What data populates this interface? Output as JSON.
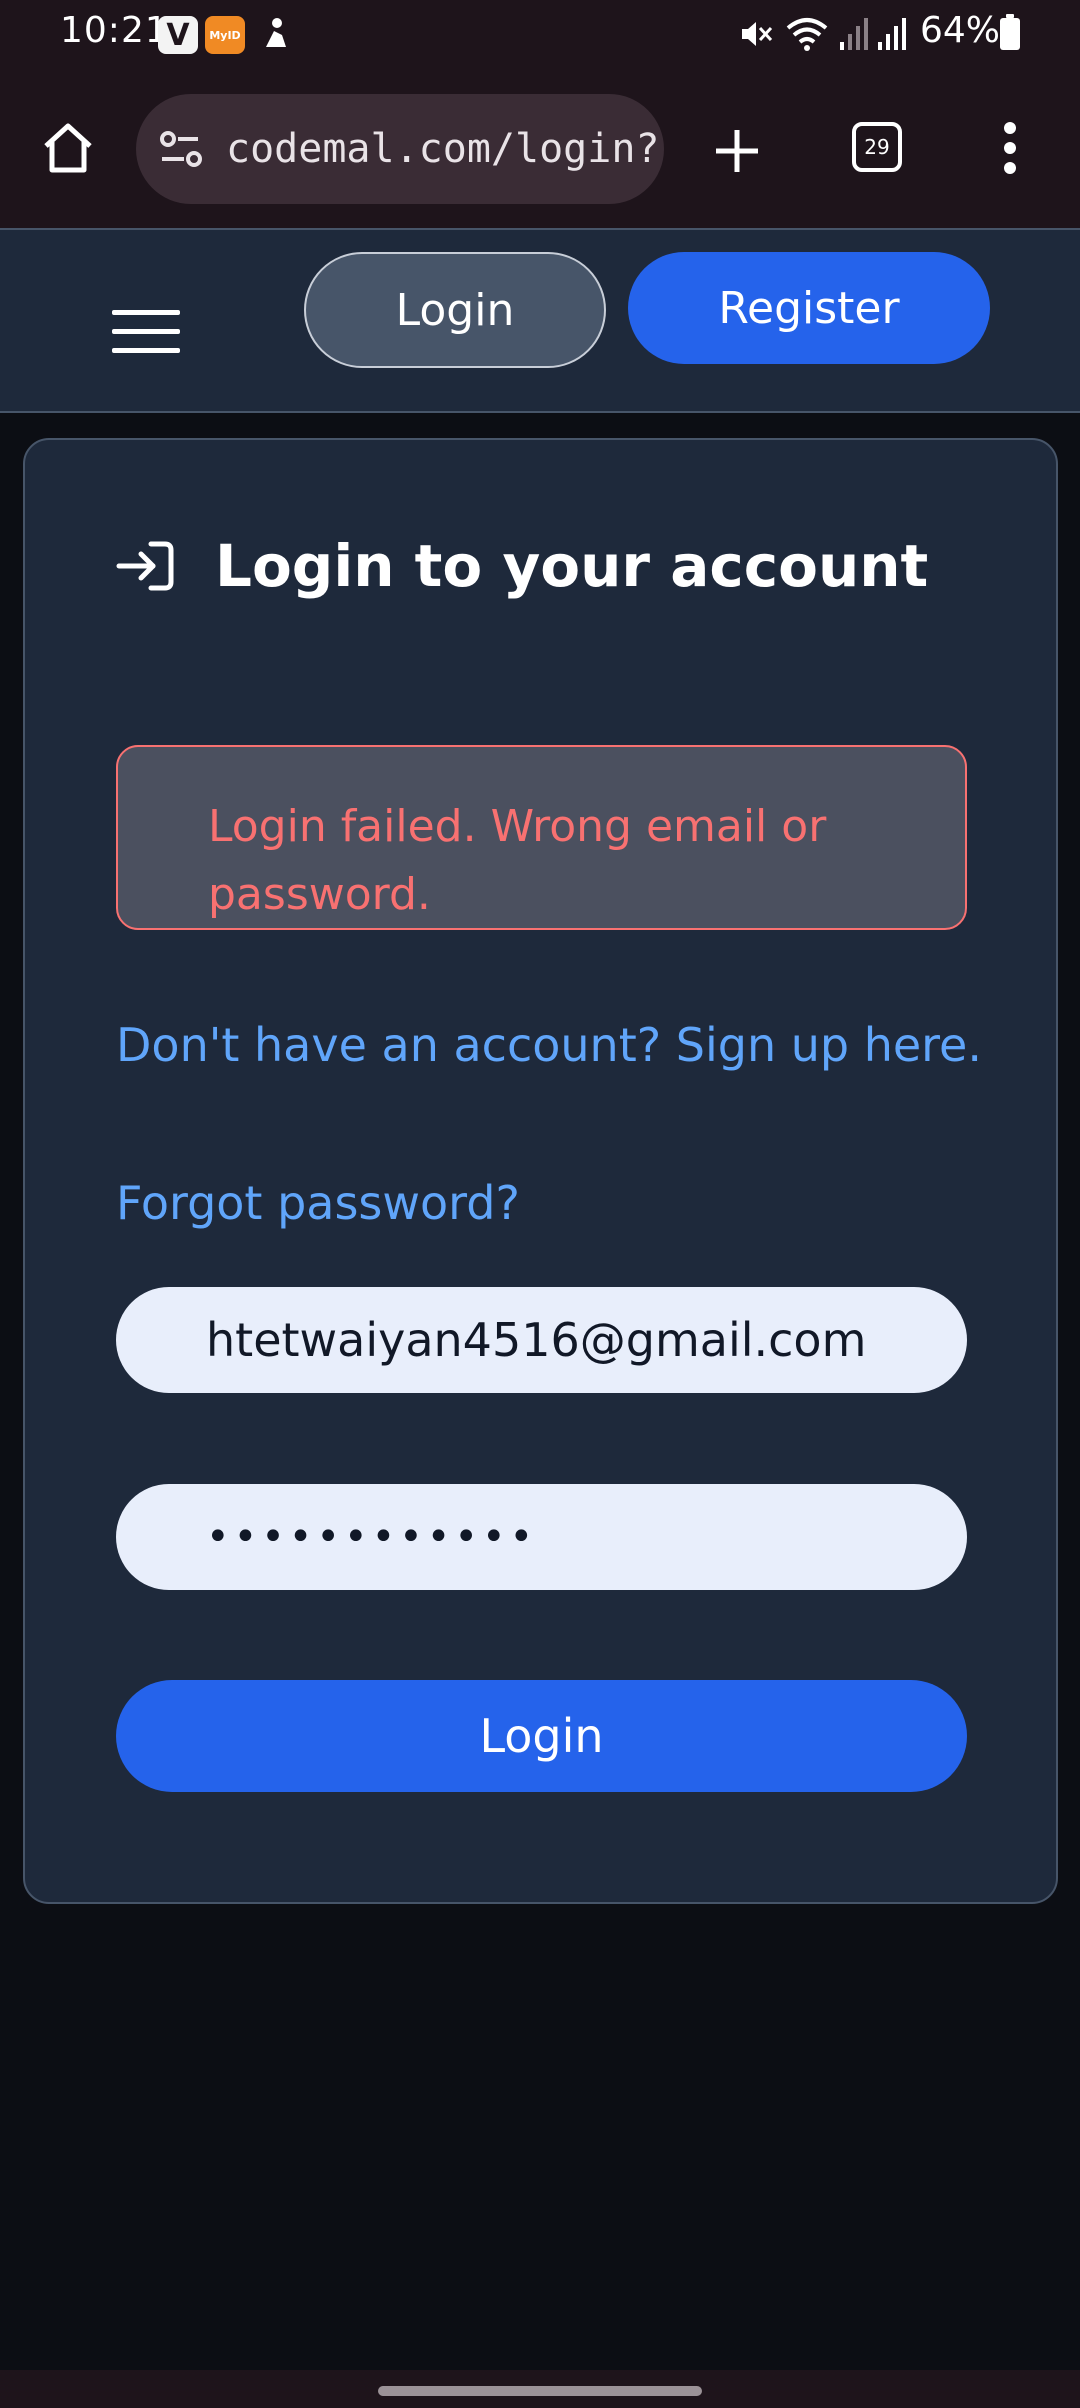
{
  "status_bar": {
    "time": "10:21",
    "app_v_label": "V",
    "app_myid_label": "MyID",
    "battery": "64%"
  },
  "browser": {
    "url": "codemal.com/login?re",
    "tab_count": "29"
  },
  "header": {
    "login_label": "Login",
    "register_label": "Register"
  },
  "card": {
    "title": "Login to your account",
    "error_message": "Login failed. Wrong email or password.",
    "signup_link": "Don't have an account? Sign up here.",
    "forgot_link": "Forgot password?",
    "email_value": "htetwaiyan4516@gmail.com",
    "password_value": "••••••••••••",
    "submit_label": "Login"
  },
  "colors": {
    "accent": "#2563eb",
    "link": "#60a5fa",
    "error": "#f87171",
    "card_bg": "#1e293b",
    "page_bg": "#0c0e14"
  }
}
